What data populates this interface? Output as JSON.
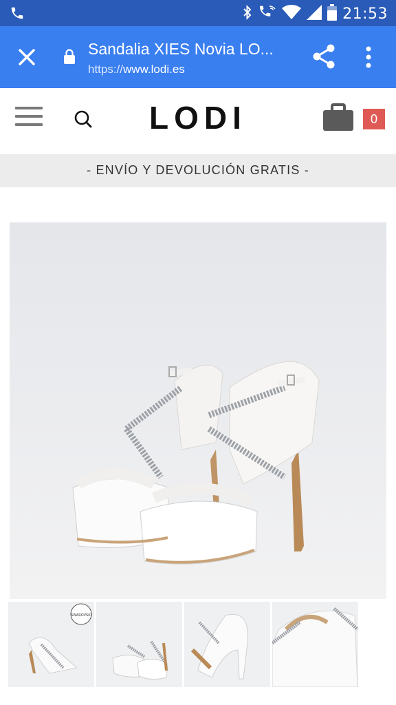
{
  "status_bar": {
    "time": "21:53"
  },
  "browser": {
    "page_title": "Sandalia XIES Novia LO...",
    "url_scheme": "https://",
    "url_host": "www.lodi.es"
  },
  "header": {
    "logo": "LODI",
    "cart_count": "0"
  },
  "promo_banner": "- ENVÍO Y DEVOLUCIÓN GRATIS -",
  "product": {
    "main_image": "white bridal platform sandals with glitter crossed straps",
    "thumbnails": [
      "side view with Swarovski seal",
      "front view pair",
      "back heel view",
      "top detail view"
    ],
    "thumbnail_badge": "SWAROVSKI"
  },
  "colors": {
    "status_bar": "#2a5bb8",
    "browser_bar": "#3a7ff0",
    "cart_badge": "#e05a55"
  }
}
